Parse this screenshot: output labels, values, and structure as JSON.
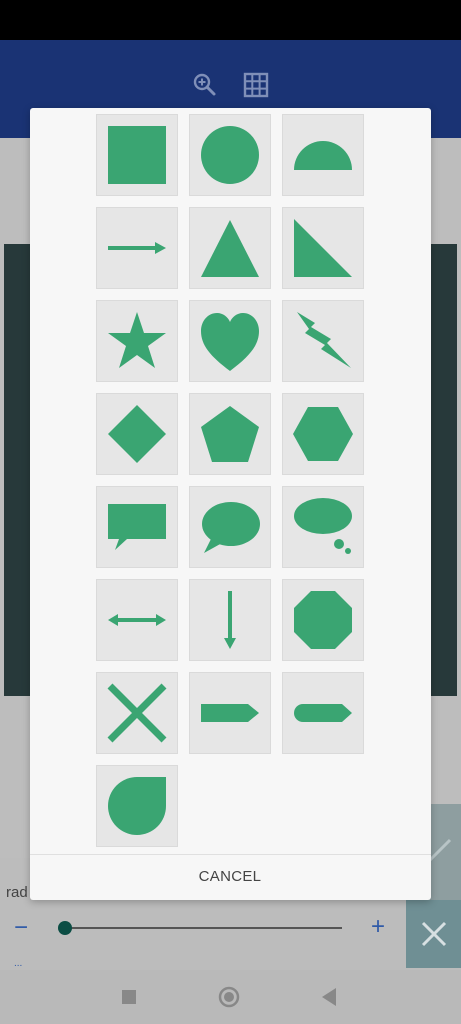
{
  "colors": {
    "accent": "#3aa572",
    "app_bar": "#1a3374",
    "dialog_bg": "#f7f7f7",
    "cell_bg": "#e6e6e6"
  },
  "toolbar": {
    "icons": [
      "zoom-in-icon",
      "grid-icon"
    ]
  },
  "shape_picker": {
    "shapes": [
      "square",
      "circle",
      "half-circle",
      "arrow-right",
      "triangle",
      "right-triangle",
      "star",
      "heart",
      "lightning-bolt",
      "diamond",
      "pentagon",
      "hexagon",
      "rectangle-speech-bubble",
      "oval-speech-bubble",
      "thought-bubble",
      "double-arrow-horizontal",
      "arrow-down",
      "octagon",
      "x-cross",
      "pentagon-arrow-right",
      "rounded-tag-right",
      "teardrop"
    ],
    "cancel_label": "CANCEL"
  },
  "bottom_panel": {
    "radius_label": "rad",
    "minus_label": "−",
    "plus_label": "+",
    "tiny_label": "...",
    "slider_value": 0.02
  },
  "nav": {
    "icons": [
      "recents-icon",
      "home-icon",
      "back-icon"
    ]
  }
}
